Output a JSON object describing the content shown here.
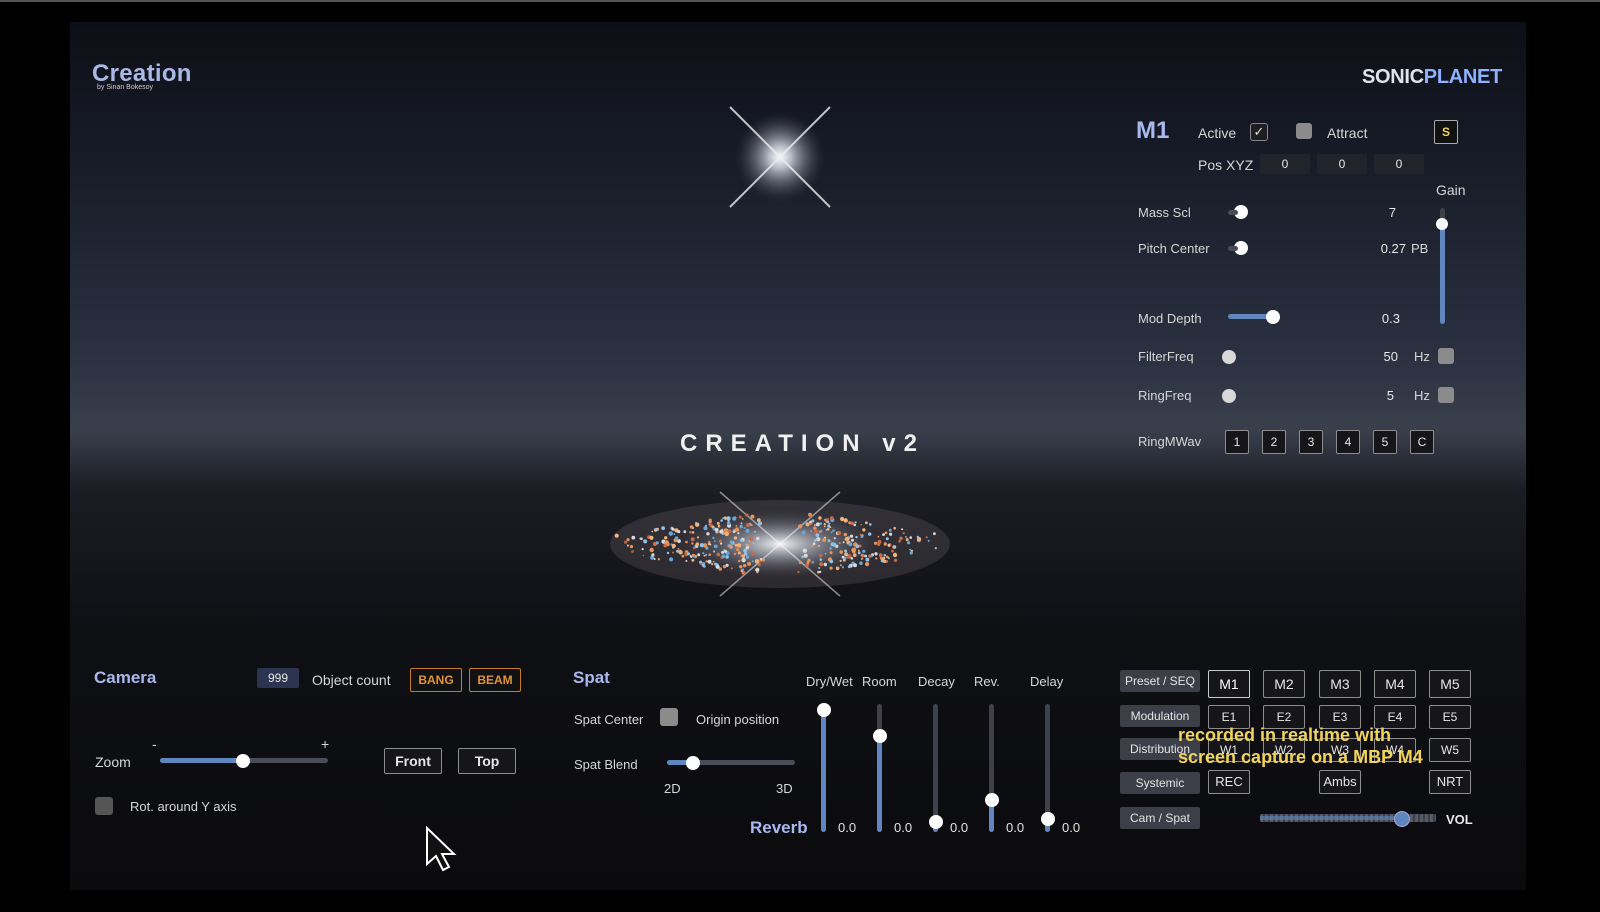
{
  "app": {
    "title": "Creation",
    "subtitle": "by Sinan Bokesoy",
    "brand_part1": "SONIC",
    "brand_part2": "PLANET",
    "scene_title": "CREATION v2"
  },
  "m1": {
    "name": "M1",
    "active_label": "Active",
    "active_checked": true,
    "attract_label": "Attract",
    "attract_checked": false,
    "s_button": "S",
    "pos_label": "Pos XYZ",
    "pos": [
      "0",
      "0",
      "0"
    ],
    "gain_label": "Gain",
    "params": [
      {
        "label": "Mass Scl",
        "value": "7",
        "unit": "",
        "level": 0.05
      },
      {
        "label": "Pitch Center",
        "value": "0.27",
        "unit": "PB",
        "level": 0.05
      },
      {
        "label": "Mod Depth",
        "value": "0.3",
        "unit": "",
        "level": 0.85
      },
      {
        "label": "FilterFreq",
        "value": "50",
        "unit": "Hz",
        "level": 0.0
      },
      {
        "label": "RingFreq",
        "value": "5",
        "unit": "Hz",
        "level": 0.0
      }
    ],
    "ringmwav_label": "RingMWav",
    "ringmwav_buttons": [
      "1",
      "2",
      "3",
      "4",
      "5",
      "C"
    ]
  },
  "camera": {
    "title": "Camera",
    "object_count_value": "999",
    "object_count_label": "Object count",
    "bang": "BANG",
    "beam": "BEAM",
    "zoom_label": "Zoom",
    "zoom_minus": "-",
    "zoom_plus": "+",
    "zoom_level": 0.5,
    "front": "Front",
    "top": "Top",
    "rot_label": "Rot. around Y axis"
  },
  "spat": {
    "title": "Spat",
    "center_label": "Spat Center",
    "origin_label": "Origin position",
    "blend_label": "Spat Blend",
    "blend_min": "2D",
    "blend_max": "3D",
    "blend_level": 0.2
  },
  "reverb": {
    "title": "Reverb",
    "faders": [
      {
        "label": "Dry/Wet",
        "value": "0.0",
        "level": 0.95
      },
      {
        "label": "Room",
        "value": "0.0",
        "level": 0.75
      },
      {
        "label": "Decay",
        "value": "0.0",
        "level": 0.08
      },
      {
        "label": "Rev.",
        "value": "0.0",
        "level": 0.25
      },
      {
        "label": "Delay",
        "value": "0.0",
        "level": 0.1
      }
    ]
  },
  "nav": {
    "side": [
      "Preset / SEQ",
      "Modulation",
      "Distribution",
      "Systemic",
      "Cam / Spat"
    ],
    "m_row": [
      "M1",
      "M2",
      "M3",
      "M4",
      "M5"
    ],
    "e_row": [
      "E1",
      "E2",
      "E3",
      "E4",
      "E5"
    ],
    "w_row": [
      "W1",
      "W2",
      "W3",
      "W4",
      "W5"
    ],
    "rec": "REC",
    "ambs": "Ambs",
    "nrt": "NRT",
    "vol_label": "VOL",
    "vol_level": 0.8
  },
  "caption": {
    "line1": "recorded in realtime with",
    "line2": "screen capture on a MBP M4"
  },
  "colors": {
    "accent": "#a9b8ef",
    "slider": "#5f86bf",
    "orange": "#e39433",
    "caption": "#f2d45d"
  }
}
